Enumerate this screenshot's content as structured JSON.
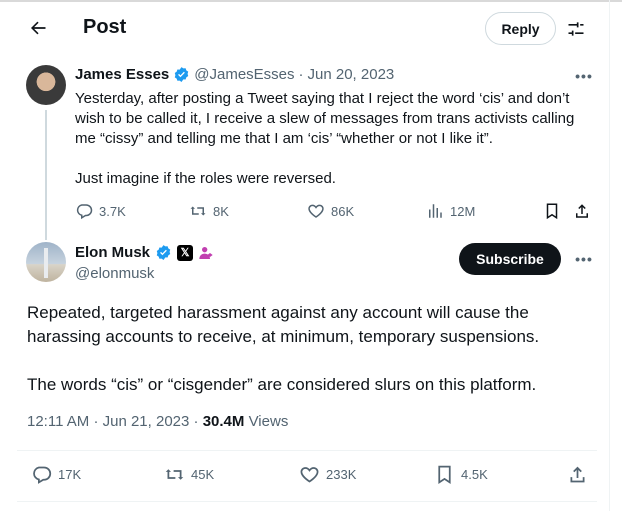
{
  "header": {
    "title": "Post",
    "reply_label": "Reply"
  },
  "parent_post": {
    "author_name": "James Esses",
    "handle": "@JamesEsses",
    "separator": "·",
    "date": "Jun 20, 2023",
    "paragraph1": "Yesterday, after posting a Tweet saying that I reject the word ‘cis’ and don’t wish to be called it, I receive a slew of messages from trans activists calling me “cissy” and telling me that I am ‘cis’ “whether or not I like it”.",
    "paragraph2": "Just imagine if the roles were reversed.",
    "stats": {
      "replies": "3.7K",
      "reposts": "8K",
      "likes": "86K",
      "views": "12M"
    }
  },
  "main_post": {
    "author_name": "Elon Musk",
    "handle": "@elonmusk",
    "subscribe_label": "Subscribe",
    "paragraph1": "Repeated, targeted harassment against any account will cause the harassing accounts to receive, at minimum, temporary suspensions.",
    "paragraph2": "The words “cis” or “cisgender” are considered slurs on this platform.",
    "time": "12:11 AM",
    "dot": "·",
    "date": "Jun 21, 2023",
    "dot2": "·",
    "views_count": "30.4M",
    "views_label": "Views",
    "stats": {
      "replies": "17K",
      "reposts": "45K",
      "likes": "233K",
      "bookmarks": "4.5K"
    }
  },
  "colors": {
    "verified": "#1d9bf0",
    "text": "#0f1419",
    "muted": "#536471",
    "affiliate": "#c13fb0"
  }
}
